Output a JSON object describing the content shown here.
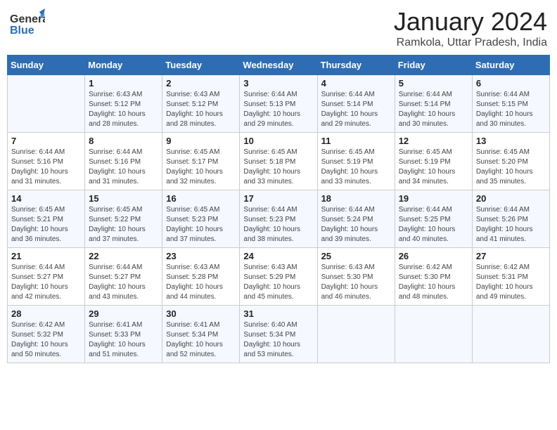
{
  "header": {
    "logo_general": "General",
    "logo_blue": "Blue",
    "month_year": "January 2024",
    "location": "Ramkola, Uttar Pradesh, India"
  },
  "days_of_week": [
    "Sunday",
    "Monday",
    "Tuesday",
    "Wednesday",
    "Thursday",
    "Friday",
    "Saturday"
  ],
  "weeks": [
    [
      {
        "day": "",
        "info": ""
      },
      {
        "day": "1",
        "info": "Sunrise: 6:43 AM\nSunset: 5:12 PM\nDaylight: 10 hours\nand 28 minutes."
      },
      {
        "day": "2",
        "info": "Sunrise: 6:43 AM\nSunset: 5:12 PM\nDaylight: 10 hours\nand 28 minutes."
      },
      {
        "day": "3",
        "info": "Sunrise: 6:44 AM\nSunset: 5:13 PM\nDaylight: 10 hours\nand 29 minutes."
      },
      {
        "day": "4",
        "info": "Sunrise: 6:44 AM\nSunset: 5:14 PM\nDaylight: 10 hours\nand 29 minutes."
      },
      {
        "day": "5",
        "info": "Sunrise: 6:44 AM\nSunset: 5:14 PM\nDaylight: 10 hours\nand 30 minutes."
      },
      {
        "day": "6",
        "info": "Sunrise: 6:44 AM\nSunset: 5:15 PM\nDaylight: 10 hours\nand 30 minutes."
      }
    ],
    [
      {
        "day": "7",
        "info": "Sunrise: 6:44 AM\nSunset: 5:16 PM\nDaylight: 10 hours\nand 31 minutes."
      },
      {
        "day": "8",
        "info": "Sunrise: 6:44 AM\nSunset: 5:16 PM\nDaylight: 10 hours\nand 31 minutes."
      },
      {
        "day": "9",
        "info": "Sunrise: 6:45 AM\nSunset: 5:17 PM\nDaylight: 10 hours\nand 32 minutes."
      },
      {
        "day": "10",
        "info": "Sunrise: 6:45 AM\nSunset: 5:18 PM\nDaylight: 10 hours\nand 33 minutes."
      },
      {
        "day": "11",
        "info": "Sunrise: 6:45 AM\nSunset: 5:19 PM\nDaylight: 10 hours\nand 33 minutes."
      },
      {
        "day": "12",
        "info": "Sunrise: 6:45 AM\nSunset: 5:19 PM\nDaylight: 10 hours\nand 34 minutes."
      },
      {
        "day": "13",
        "info": "Sunrise: 6:45 AM\nSunset: 5:20 PM\nDaylight: 10 hours\nand 35 minutes."
      }
    ],
    [
      {
        "day": "14",
        "info": "Sunrise: 6:45 AM\nSunset: 5:21 PM\nDaylight: 10 hours\nand 36 minutes."
      },
      {
        "day": "15",
        "info": "Sunrise: 6:45 AM\nSunset: 5:22 PM\nDaylight: 10 hours\nand 37 minutes."
      },
      {
        "day": "16",
        "info": "Sunrise: 6:45 AM\nSunset: 5:23 PM\nDaylight: 10 hours\nand 37 minutes."
      },
      {
        "day": "17",
        "info": "Sunrise: 6:44 AM\nSunset: 5:23 PM\nDaylight: 10 hours\nand 38 minutes."
      },
      {
        "day": "18",
        "info": "Sunrise: 6:44 AM\nSunset: 5:24 PM\nDaylight: 10 hours\nand 39 minutes."
      },
      {
        "day": "19",
        "info": "Sunrise: 6:44 AM\nSunset: 5:25 PM\nDaylight: 10 hours\nand 40 minutes."
      },
      {
        "day": "20",
        "info": "Sunrise: 6:44 AM\nSunset: 5:26 PM\nDaylight: 10 hours\nand 41 minutes."
      }
    ],
    [
      {
        "day": "21",
        "info": "Sunrise: 6:44 AM\nSunset: 5:27 PM\nDaylight: 10 hours\nand 42 minutes."
      },
      {
        "day": "22",
        "info": "Sunrise: 6:44 AM\nSunset: 5:27 PM\nDaylight: 10 hours\nand 43 minutes."
      },
      {
        "day": "23",
        "info": "Sunrise: 6:43 AM\nSunset: 5:28 PM\nDaylight: 10 hours\nand 44 minutes."
      },
      {
        "day": "24",
        "info": "Sunrise: 6:43 AM\nSunset: 5:29 PM\nDaylight: 10 hours\nand 45 minutes."
      },
      {
        "day": "25",
        "info": "Sunrise: 6:43 AM\nSunset: 5:30 PM\nDaylight: 10 hours\nand 46 minutes."
      },
      {
        "day": "26",
        "info": "Sunrise: 6:42 AM\nSunset: 5:30 PM\nDaylight: 10 hours\nand 48 minutes."
      },
      {
        "day": "27",
        "info": "Sunrise: 6:42 AM\nSunset: 5:31 PM\nDaylight: 10 hours\nand 49 minutes."
      }
    ],
    [
      {
        "day": "28",
        "info": "Sunrise: 6:42 AM\nSunset: 5:32 PM\nDaylight: 10 hours\nand 50 minutes."
      },
      {
        "day": "29",
        "info": "Sunrise: 6:41 AM\nSunset: 5:33 PM\nDaylight: 10 hours\nand 51 minutes."
      },
      {
        "day": "30",
        "info": "Sunrise: 6:41 AM\nSunset: 5:34 PM\nDaylight: 10 hours\nand 52 minutes."
      },
      {
        "day": "31",
        "info": "Sunrise: 6:40 AM\nSunset: 5:34 PM\nDaylight: 10 hours\nand 53 minutes."
      },
      {
        "day": "",
        "info": ""
      },
      {
        "day": "",
        "info": ""
      },
      {
        "day": "",
        "info": ""
      }
    ]
  ]
}
